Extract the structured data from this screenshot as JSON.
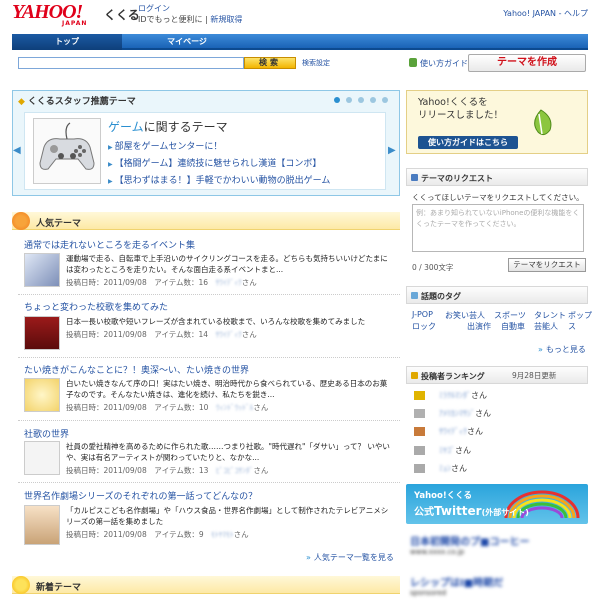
{
  "header": {
    "logo_text": "YAHOO!",
    "logo_sub": "JAPAN",
    "service_name": "くくる",
    "login_link": "ログイン",
    "login_desc": "IDでもっと便利に",
    "register_link": "新規取得",
    "right_links": "Yahoo! JAPAN - ヘルプ"
  },
  "nav": {
    "tabs": [
      {
        "label": "トップ"
      },
      {
        "label": "マイページ"
      }
    ]
  },
  "search": {
    "button": "検索",
    "settings": "検索設定",
    "howto": "使い方ガイド",
    "create_button": "テーマを作成"
  },
  "staff_theme": {
    "title": "くくるスタッフ推薦テーマ",
    "heading_hl": "ゲーム",
    "heading_rest": "に関するテーマ",
    "links": [
      "部屋をゲームセンターに！",
      "【格闘ゲーム】連続技に魅せられし漢道【コンボ】",
      "【思わずはまる！】手軽でかわいい動物の脱出ゲーム"
    ]
  },
  "popular": {
    "title": "人気テーマ",
    "items": [
      {
        "title": "通常では走れないところを走るイベント集",
        "desc": "運動場で走る、自転車で上手沿いのサイクリングコースを走る。どちらも気持ちいいけどたまには変わったところを走りたい。そんな面白走る系イベントまと...",
        "date": "投稿日時：2011/09/08",
        "count": "アイテム数：16",
        "user": "ｻﾜｲﾃﾞｨｸ",
        "san": "さん"
      },
      {
        "title": "ちょっと変わった校歌を集めてみた",
        "desc": "日本一長い校歌や短いフレーズが含まれている校歌まで、いろんな校歌を集めてみました",
        "date": "投稿日時：2011/09/08",
        "count": "アイテム数：14",
        "user": "ｻﾜｲﾃﾞｨｸ",
        "san": "さん"
      },
      {
        "title": "たい焼きがこんなことに？！奥深〜い、たい焼きの世界",
        "desc": "白いたい焼きなんて序の口！実はたい焼き、明治時代から食べられている、歴史ある日本のお菓子なのです。そんなたい焼きは、進化を続け、私たちを鋭き...",
        "date": "投稿日時：2011/09/08",
        "count": "アイテム数：10",
        "user": "ｳｨﾝﾄﾞｳｯﾄﾞﾙ",
        "san": "さん"
      },
      {
        "title": "社歌の世界",
        "desc": "社員の愛社精神を高めるために作られた歌……つまり社歌。\"時代遅れ\"「ダサい」って？ いやいや、実は有名アーティストが関わっていたりと、なかな...",
        "date": "投稿日時：2011/09/08",
        "count": "アイテム数：13",
        "user": "ﾋﾟｺﾋﾟｺｻﾝﾀﾞ",
        "san": "さん"
      },
      {
        "title": "世界名作劇場シリーズのそれぞれの第一話ってどんなの？",
        "desc": "「カルピスこども名作劇場」や「ハウス食品・世界名作劇場」として制作されたテレビアニメシリーズの第一話を集めました",
        "date": "投稿日時：2011/09/08",
        "count": "アイテム数：9",
        "user": "ﾓﾄﾔﾏﾓﾄ",
        "san": "さん"
      }
    ],
    "more_link": "人気テーマ一覧を見る"
  },
  "new_theme": {
    "title": "新着テーマ"
  },
  "promo": {
    "line1": "Yahoo!くくるを",
    "line2": "リリースしました！",
    "button": "使い方ガイドはこちら"
  },
  "request": {
    "title": "テーマのリクエスト",
    "desc": "くくってほしいテーマをリクエストしてください。",
    "placeholder": "例：あまり知られていないiPhoneの便利な機能をくくったテーマを作ってください。",
    "counter": "0 / 300文字",
    "button": "テーマをリクエスト"
  },
  "tags": {
    "title": "話題のタグ",
    "items": [
      "J-POP",
      "お笑い芸人",
      "スポーツ",
      "タレント",
      "ポップ",
      "ロック",
      "出演作",
      "自動車",
      "芸能人",
      "ス"
    ],
    "more": "もっと見る"
  },
  "ranking": {
    "title": "投稿者ランキング",
    "date": "9月28日更新",
    "users": [
      {
        "name": "ﾐﾗｸﾙﾏﾝﾀﾞ",
        "san": "さん"
      },
      {
        "name": "ｱﾒﾘｶﾝﾏｻｼﾞ",
        "san": "さん"
      },
      {
        "name": "ｻﾜｲﾃﾞｨｸ",
        "san": "さん"
      },
      {
        "name": "ﾐﾔｺﾞ",
        "san": "さん"
      },
      {
        "name": "ﾐｮﾝ",
        "san": "さん"
      }
    ]
  },
  "twitter": {
    "line1": "Yahoo!くくる",
    "line2a": "公式",
    "line2b": "Twitter",
    "line2c": "(外部サイト)"
  },
  "ads": [
    {
      "title": "日本初開発のプ■コーヒー",
      "sub": "www.xxxx.co.jp"
    },
    {
      "title": "レシップはI■時期だ",
      "sub": "sponsored"
    }
  ],
  "colors": {
    "brand_red": "#e0001a",
    "link_blue": "#2553a3",
    "nav_blue": "#1a63b6"
  }
}
